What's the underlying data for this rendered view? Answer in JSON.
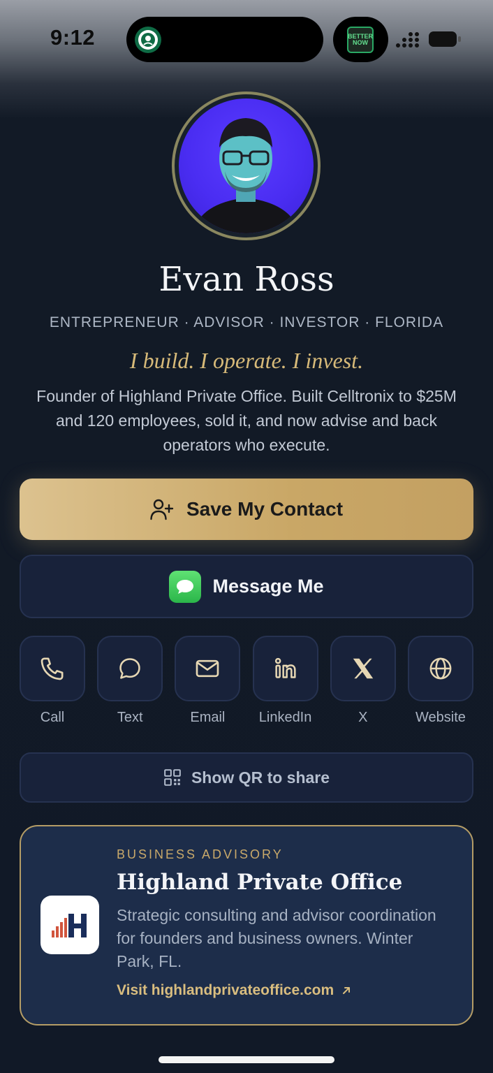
{
  "status": {
    "time": "9:12",
    "live_activity_text": "BETTER NOW"
  },
  "profile": {
    "name": "Evan Ross",
    "tagline": "ENTREPRENEUR · ADVISOR · INVESTOR · FLORIDA",
    "motto": "I build. I operate. I invest.",
    "bio": "Founder of Highland Private Office. Built Celltronix to $25M and 120 employees, sold it, and now advise and back operators who execute."
  },
  "buttons": {
    "save_contact": "Save My Contact",
    "message_me": "Message Me",
    "show_qr": "Show QR to share"
  },
  "actions": [
    {
      "label": "Call",
      "icon": "phone-icon"
    },
    {
      "label": "Text",
      "icon": "chat-bubble-icon"
    },
    {
      "label": "Email",
      "icon": "mail-icon"
    },
    {
      "label": "LinkedIn",
      "icon": "linkedin-icon"
    },
    {
      "label": "X",
      "icon": "x-logo-icon"
    },
    {
      "label": "Website",
      "icon": "globe-icon"
    }
  ],
  "business_card": {
    "kicker": "BUSINESS ADVISORY",
    "title": "Highland Private Office",
    "description": "Strategic consulting and advisor coordination for founders and business owners. Winter Park, FL.",
    "link": "Visit highlandprivateoffice.com",
    "logo_letter": "H"
  },
  "colors": {
    "background": "#111927",
    "gold": "#c9a766",
    "card": "#1d2d4a",
    "button": "#18223a"
  }
}
